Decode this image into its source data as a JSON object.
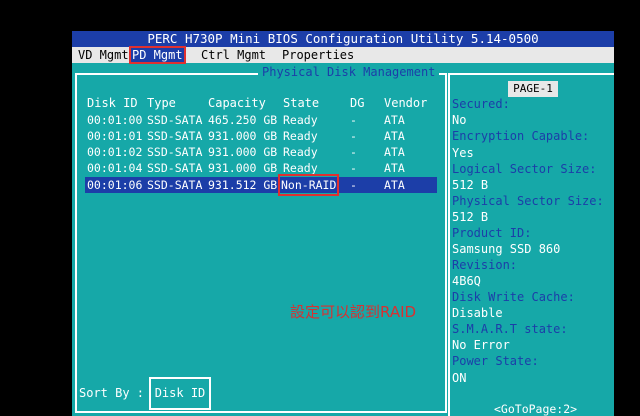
{
  "title": "PERC H730P Mini BIOS Configuration Utility 5.14-0500",
  "menu": [
    {
      "label": "VD Mgmt"
    },
    {
      "label": "PD Mgmt"
    },
    {
      "label": "Ctrl Mgmt"
    },
    {
      "label": "Properties"
    }
  ],
  "panel_title": "Physical Disk Management",
  "columns": [
    "Disk ID",
    "Type",
    "Capacity",
    "State",
    "DG",
    "Vendor"
  ],
  "disks": [
    {
      "id": "00:01:00",
      "type": "SSD-SATA",
      "capacity": "465.250 GB",
      "state": "Ready",
      "dg": "-",
      "vendor": "ATA"
    },
    {
      "id": "00:01:01",
      "type": "SSD-SATA",
      "capacity": "931.000 GB",
      "state": "Ready",
      "dg": "-",
      "vendor": "ATA"
    },
    {
      "id": "00:01:02",
      "type": "SSD-SATA",
      "capacity": "931.000 GB",
      "state": "Ready",
      "dg": "-",
      "vendor": "ATA"
    },
    {
      "id": "00:01:04",
      "type": "SSD-SATA",
      "capacity": "931.000 GB",
      "state": "Ready",
      "dg": "-",
      "vendor": "ATA"
    },
    {
      "id": "00:01:06",
      "type": "SSD-SATA",
      "capacity": "931.512 GB",
      "state": "Non-RAID",
      "dg": "-",
      "vendor": "ATA"
    }
  ],
  "selected_disk_index": 4,
  "page_badge": "PAGE-1",
  "properties": {
    "secured_label": "Secured:",
    "secured_value": "No",
    "encryption_label": "Encryption Capable:",
    "encryption_value": "Yes",
    "sector_label": "Logical Sector Size:",
    "sector_value": "512 B",
    "phys_sector_label": "Physical Sector Size:",
    "phys_sector_value": "512 B",
    "product_label": "Product ID:",
    "product_value": "Samsung SSD 860",
    "revision_label": "Revision:",
    "revision_value": "4B6Q",
    "write_cache_label": "Disk Write Cache:",
    "write_cache_value": "Disable",
    "smart_label": "S.M.A.R.T state:",
    "smart_value": "No Error",
    "power_label": "Power State:",
    "power_value": "ON"
  },
  "annotation": "設定可以認到RAID",
  "sort_label": "Sort By :",
  "sort_value": "Disk ID",
  "goto_page": "<GoToPage:2>",
  "colors": {
    "background": "#16a8a8",
    "title_bar": "#1c3ea8",
    "highlight_box": "#e03030",
    "label_text": "#1c3ea8"
  }
}
